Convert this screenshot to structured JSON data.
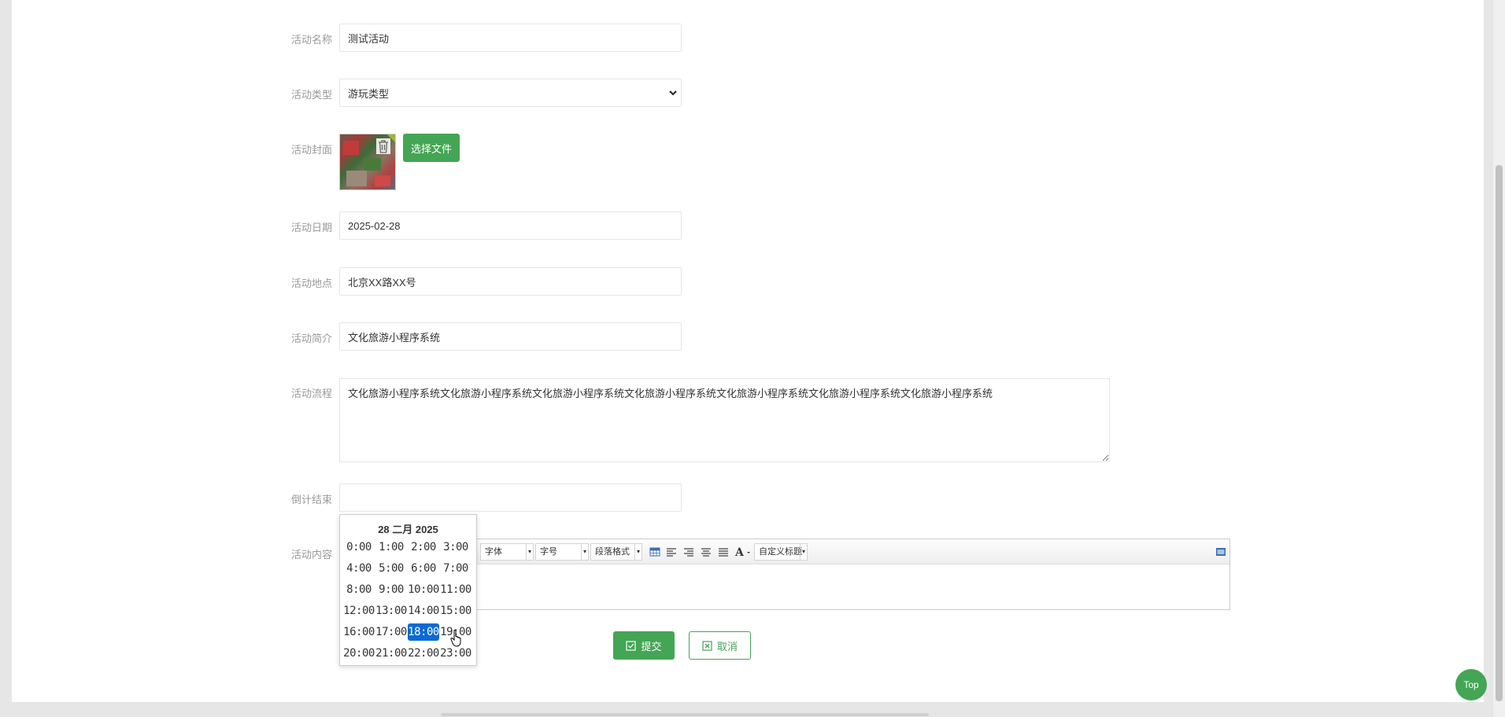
{
  "form": {
    "name": {
      "label": "活动名称",
      "value": "测试活动"
    },
    "type": {
      "label": "活动类型",
      "value": "游玩类型"
    },
    "cover": {
      "label": "活动封面",
      "choose_label": "选择文件"
    },
    "date": {
      "label": "活动日期",
      "value": "2025-02-28"
    },
    "location": {
      "label": "活动地点",
      "value": "北京XX路XX号"
    },
    "intro": {
      "label": "活动简介",
      "value": "文化旅游小程序系统"
    },
    "flow": {
      "label": "活动流程",
      "value": "文化旅游小程序系统文化旅游小程序系统文化旅游小程序系统文化旅游小程序系统文化旅游小程序系统文化旅游小程序系统文化旅游小程序系统"
    },
    "countdown": {
      "label": "倒计结束",
      "value": ""
    },
    "content": {
      "label": "活动内容"
    }
  },
  "editor": {
    "font_family": "字体",
    "font_size": "字号",
    "paragraph": "段落格式",
    "custom_heading": "自定义标题",
    "icons": [
      "table-icon",
      "align-left-icon",
      "align-right-icon",
      "align-center-icon",
      "justify-icon",
      "font-color-icon",
      "source-icon"
    ]
  },
  "picker": {
    "title": "28 二月 2025",
    "hours": [
      "0:00",
      "1:00",
      "2:00",
      "3:00",
      "4:00",
      "5:00",
      "6:00",
      "7:00",
      "8:00",
      "9:00",
      "10:00",
      "11:00",
      "12:00",
      "13:00",
      "14:00",
      "15:00",
      "16:00",
      "17:00",
      "18:00",
      "19:00",
      "20:00",
      "21:00",
      "22:00",
      "23:00"
    ],
    "selected": "18:00"
  },
  "actions": {
    "submit": "提交",
    "cancel": "取消"
  },
  "top_button": "Top",
  "colors": {
    "primary": "#44a554",
    "selected": "#0a6ad4",
    "label": "#999999"
  }
}
